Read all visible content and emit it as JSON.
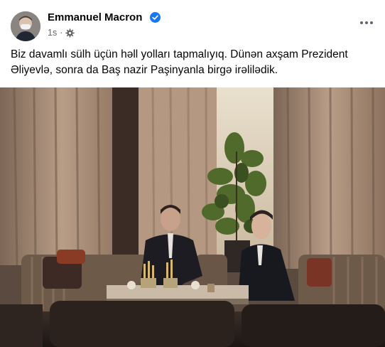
{
  "post": {
    "author": "Emmanuel Macron",
    "time": "1s",
    "text_line1": "Biz davamlı sülh üçün həll yolları tapmalıyıq. Dünən axşam Prezident",
    "text_line2": "Əliyevlə, sonra da Baş nazir Paşinyanla birgə irəlilədik.",
    "icons": {
      "verified": "verified-badge-icon",
      "audience": "gear-icon",
      "more": "more-options-icon"
    }
  },
  "colors": {
    "verified_blue": "#1877f2",
    "meta_gray": "#65676b",
    "curtain": "#b59a85",
    "sofa": "#6e5a49"
  }
}
